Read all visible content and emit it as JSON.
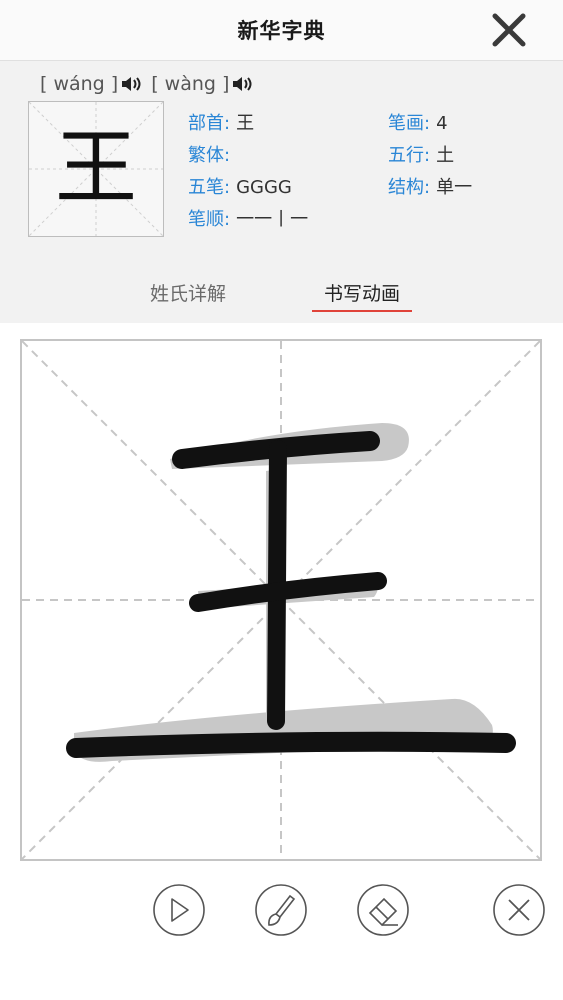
{
  "header": {
    "title": "新华字典"
  },
  "entry": {
    "character": "王",
    "pinyin": [
      "[ wáng ]",
      "[ wàng ]"
    ],
    "info": {
      "radical_label": "部首:",
      "radical_value": "王",
      "strokes_label": "笔画:",
      "strokes_value": "4",
      "traditional_label": "繁体:",
      "traditional_value": "",
      "five_elements_label": "五行:",
      "five_elements_value": "土",
      "wubi_label": "五笔:",
      "wubi_value": "GGGG",
      "structure_label": "结构:",
      "structure_value": "单一",
      "stroke_order_label": "笔顺:",
      "stroke_order_value": "一一丨一"
    }
  },
  "tabs": [
    {
      "label": "姓氏详解",
      "active": false
    },
    {
      "label": "书写动画",
      "active": true
    }
  ],
  "controls": [
    "play-icon",
    "brush-icon",
    "eraser-icon",
    "close-circle-icon"
  ],
  "colors": {
    "accent_blue": "#2a86d6",
    "tab_underline": "#e0433a",
    "stroke": "#111111",
    "stroke_shadow": "#c8c8c8"
  }
}
